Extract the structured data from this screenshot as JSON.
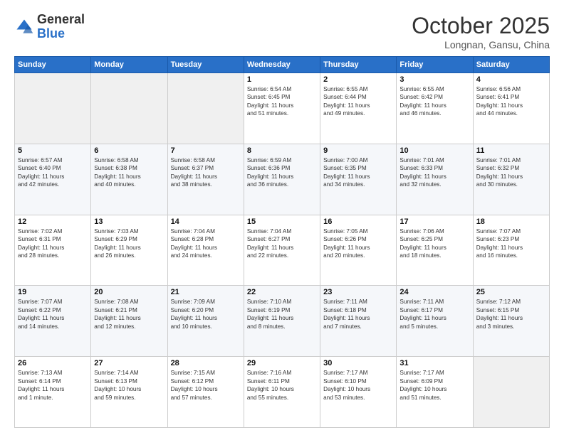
{
  "header": {
    "logo_general": "General",
    "logo_blue": "Blue",
    "month_title": "October 2025",
    "location": "Longnan, Gansu, China"
  },
  "days_of_week": [
    "Sunday",
    "Monday",
    "Tuesday",
    "Wednesday",
    "Thursday",
    "Friday",
    "Saturday"
  ],
  "weeks": [
    {
      "days": [
        {
          "num": "",
          "info": ""
        },
        {
          "num": "",
          "info": ""
        },
        {
          "num": "",
          "info": ""
        },
        {
          "num": "1",
          "info": "Sunrise: 6:54 AM\nSunset: 6:45 PM\nDaylight: 11 hours\nand 51 minutes."
        },
        {
          "num": "2",
          "info": "Sunrise: 6:55 AM\nSunset: 6:44 PM\nDaylight: 11 hours\nand 49 minutes."
        },
        {
          "num": "3",
          "info": "Sunrise: 6:55 AM\nSunset: 6:42 PM\nDaylight: 11 hours\nand 46 minutes."
        },
        {
          "num": "4",
          "info": "Sunrise: 6:56 AM\nSunset: 6:41 PM\nDaylight: 11 hours\nand 44 minutes."
        }
      ]
    },
    {
      "days": [
        {
          "num": "5",
          "info": "Sunrise: 6:57 AM\nSunset: 6:40 PM\nDaylight: 11 hours\nand 42 minutes."
        },
        {
          "num": "6",
          "info": "Sunrise: 6:58 AM\nSunset: 6:38 PM\nDaylight: 11 hours\nand 40 minutes."
        },
        {
          "num": "7",
          "info": "Sunrise: 6:58 AM\nSunset: 6:37 PM\nDaylight: 11 hours\nand 38 minutes."
        },
        {
          "num": "8",
          "info": "Sunrise: 6:59 AM\nSunset: 6:36 PM\nDaylight: 11 hours\nand 36 minutes."
        },
        {
          "num": "9",
          "info": "Sunrise: 7:00 AM\nSunset: 6:35 PM\nDaylight: 11 hours\nand 34 minutes."
        },
        {
          "num": "10",
          "info": "Sunrise: 7:01 AM\nSunset: 6:33 PM\nDaylight: 11 hours\nand 32 minutes."
        },
        {
          "num": "11",
          "info": "Sunrise: 7:01 AM\nSunset: 6:32 PM\nDaylight: 11 hours\nand 30 minutes."
        }
      ]
    },
    {
      "days": [
        {
          "num": "12",
          "info": "Sunrise: 7:02 AM\nSunset: 6:31 PM\nDaylight: 11 hours\nand 28 minutes."
        },
        {
          "num": "13",
          "info": "Sunrise: 7:03 AM\nSunset: 6:29 PM\nDaylight: 11 hours\nand 26 minutes."
        },
        {
          "num": "14",
          "info": "Sunrise: 7:04 AM\nSunset: 6:28 PM\nDaylight: 11 hours\nand 24 minutes."
        },
        {
          "num": "15",
          "info": "Sunrise: 7:04 AM\nSunset: 6:27 PM\nDaylight: 11 hours\nand 22 minutes."
        },
        {
          "num": "16",
          "info": "Sunrise: 7:05 AM\nSunset: 6:26 PM\nDaylight: 11 hours\nand 20 minutes."
        },
        {
          "num": "17",
          "info": "Sunrise: 7:06 AM\nSunset: 6:25 PM\nDaylight: 11 hours\nand 18 minutes."
        },
        {
          "num": "18",
          "info": "Sunrise: 7:07 AM\nSunset: 6:23 PM\nDaylight: 11 hours\nand 16 minutes."
        }
      ]
    },
    {
      "days": [
        {
          "num": "19",
          "info": "Sunrise: 7:07 AM\nSunset: 6:22 PM\nDaylight: 11 hours\nand 14 minutes."
        },
        {
          "num": "20",
          "info": "Sunrise: 7:08 AM\nSunset: 6:21 PM\nDaylight: 11 hours\nand 12 minutes."
        },
        {
          "num": "21",
          "info": "Sunrise: 7:09 AM\nSunset: 6:20 PM\nDaylight: 11 hours\nand 10 minutes."
        },
        {
          "num": "22",
          "info": "Sunrise: 7:10 AM\nSunset: 6:19 PM\nDaylight: 11 hours\nand 8 minutes."
        },
        {
          "num": "23",
          "info": "Sunrise: 7:11 AM\nSunset: 6:18 PM\nDaylight: 11 hours\nand 7 minutes."
        },
        {
          "num": "24",
          "info": "Sunrise: 7:11 AM\nSunset: 6:17 PM\nDaylight: 11 hours\nand 5 minutes."
        },
        {
          "num": "25",
          "info": "Sunrise: 7:12 AM\nSunset: 6:15 PM\nDaylight: 11 hours\nand 3 minutes."
        }
      ]
    },
    {
      "days": [
        {
          "num": "26",
          "info": "Sunrise: 7:13 AM\nSunset: 6:14 PM\nDaylight: 11 hours\nand 1 minute."
        },
        {
          "num": "27",
          "info": "Sunrise: 7:14 AM\nSunset: 6:13 PM\nDaylight: 10 hours\nand 59 minutes."
        },
        {
          "num": "28",
          "info": "Sunrise: 7:15 AM\nSunset: 6:12 PM\nDaylight: 10 hours\nand 57 minutes."
        },
        {
          "num": "29",
          "info": "Sunrise: 7:16 AM\nSunset: 6:11 PM\nDaylight: 10 hours\nand 55 minutes."
        },
        {
          "num": "30",
          "info": "Sunrise: 7:17 AM\nSunset: 6:10 PM\nDaylight: 10 hours\nand 53 minutes."
        },
        {
          "num": "31",
          "info": "Sunrise: 7:17 AM\nSunset: 6:09 PM\nDaylight: 10 hours\nand 51 minutes."
        },
        {
          "num": "",
          "info": ""
        }
      ]
    }
  ]
}
